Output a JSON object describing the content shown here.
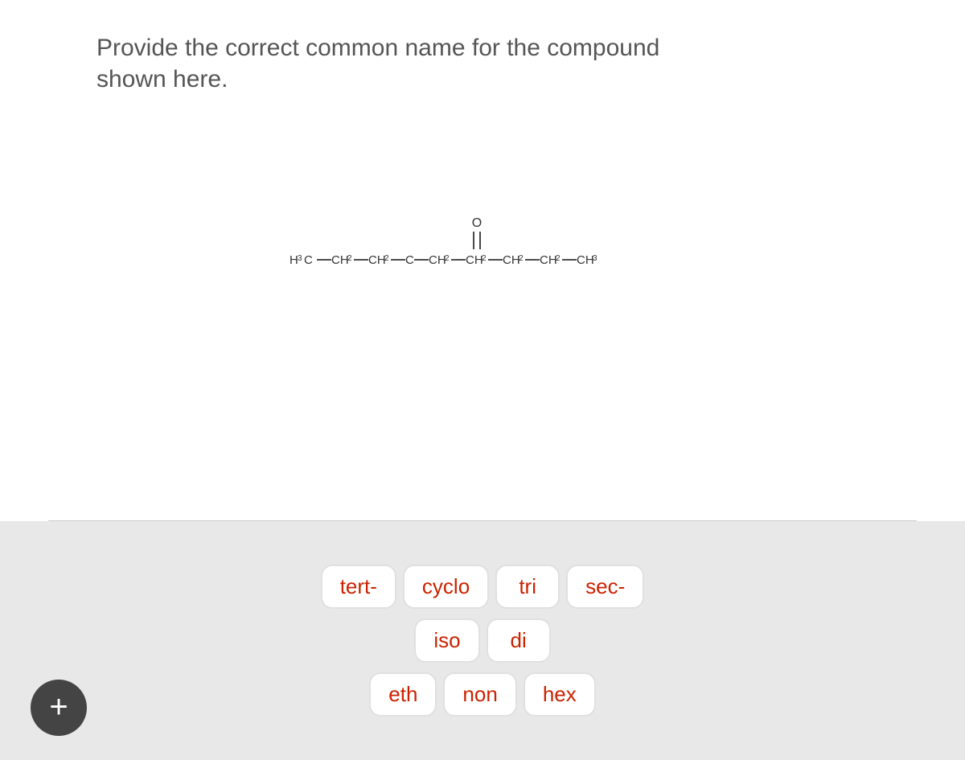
{
  "question": {
    "text_line1": "Provide the correct common name for the compound",
    "text_line2": "shown here."
  },
  "molecule": {
    "formula": "H₃C−CH₂−CH₂−C−CH₂−CH₂−CH₂−CH₂−CH₃",
    "label_oxygen": "O",
    "label_double_bond": "||"
  },
  "buttons": {
    "row1": [
      {
        "label": "tert-",
        "id": "tert"
      },
      {
        "label": "cyclo",
        "id": "cyclo"
      },
      {
        "label": "tri",
        "id": "tri"
      },
      {
        "label": "sec-",
        "id": "sec"
      }
    ],
    "row2": [
      {
        "label": "iso",
        "id": "iso"
      },
      {
        "label": "di",
        "id": "di"
      }
    ],
    "row3": [
      {
        "label": "eth",
        "id": "eth"
      },
      {
        "label": "non",
        "id": "non"
      },
      {
        "label": "hex",
        "id": "hex"
      }
    ]
  },
  "plus_button": {
    "label": "+"
  }
}
